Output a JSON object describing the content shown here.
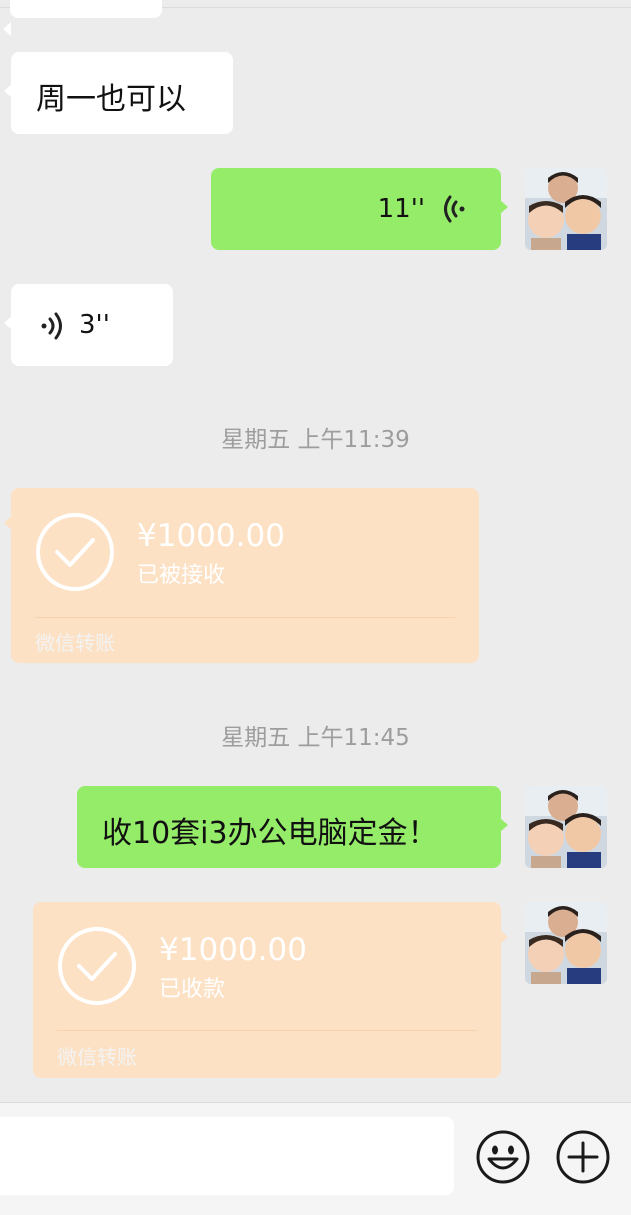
{
  "messages": [
    {
      "id": "m1",
      "side": "left",
      "type": "text",
      "text": "周一也可以"
    },
    {
      "id": "m2",
      "side": "right",
      "type": "voice",
      "duration": "11''"
    },
    {
      "id": "m3",
      "side": "left",
      "type": "voice",
      "duration": "3''"
    },
    {
      "id": "ts1",
      "type": "timestamp",
      "text": "星期五 上午11:39"
    },
    {
      "id": "m4",
      "side": "left",
      "type": "transfer",
      "amount": "¥1000.00",
      "status": "已被接收",
      "footer": "微信转账"
    },
    {
      "id": "ts2",
      "type": "timestamp",
      "text": "星期五 上午11:45"
    },
    {
      "id": "m5",
      "side": "right",
      "type": "text",
      "text": "收10套i3办公电脑定金！"
    },
    {
      "id": "m6",
      "side": "right",
      "type": "transfer",
      "amount": "¥1000.00",
      "status": "已收款",
      "footer": "微信转账"
    }
  ],
  "input_bar": {
    "emoji_icon": "smiley-face-icon",
    "plus_icon": "plus-circle-icon"
  },
  "colors": {
    "background": "#ececec",
    "green_bubble": "#95ec69",
    "white_bubble": "#ffffff",
    "transfer_bubble": "#fce1c4",
    "timestamp_text": "#9d9d9d"
  }
}
